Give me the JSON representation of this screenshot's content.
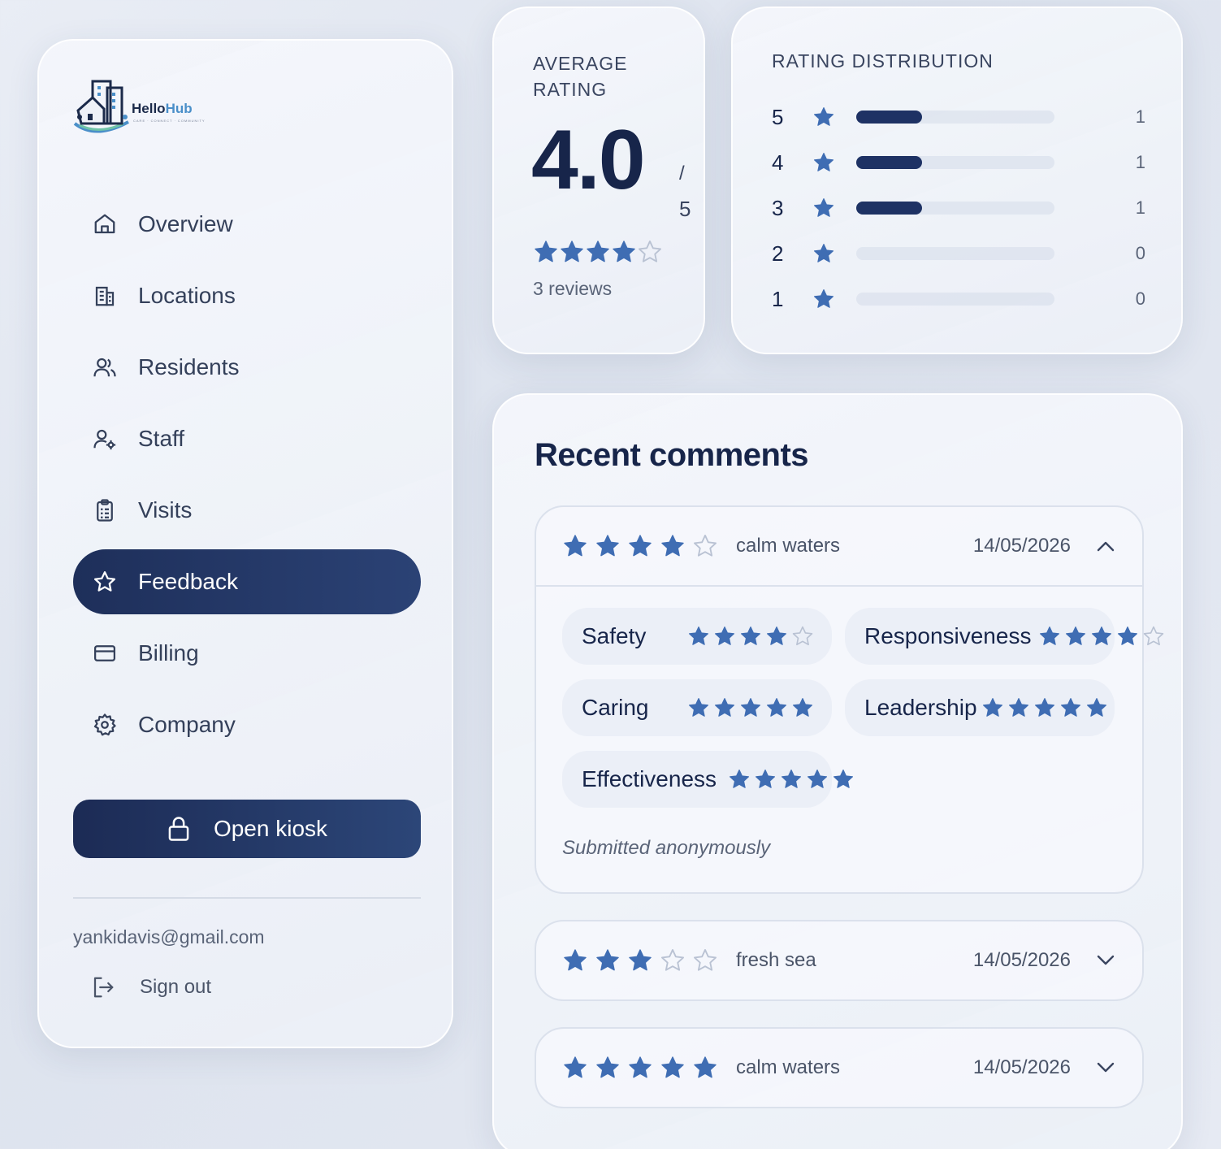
{
  "brand": {
    "name_a": "Hello",
    "name_b": "Hub",
    "tagline": "CARE · CONNECT · COMMUNITY"
  },
  "sidebar": {
    "items": [
      {
        "label": "Overview",
        "icon": "home-icon",
        "active": false
      },
      {
        "label": "Locations",
        "icon": "building-icon",
        "active": false
      },
      {
        "label": "Residents",
        "icon": "users-icon",
        "active": false
      },
      {
        "label": "Staff",
        "icon": "user-gear-icon",
        "active": false
      },
      {
        "label": "Visits",
        "icon": "clipboard-icon",
        "active": false
      },
      {
        "label": "Feedback",
        "icon": "star-icon",
        "active": true
      },
      {
        "label": "Billing",
        "icon": "card-icon",
        "active": false
      },
      {
        "label": "Company",
        "icon": "gear-icon",
        "active": false
      }
    ],
    "kiosk_label": "Open kiosk",
    "email": "yankidavis@gmail.com",
    "signout_label": "Sign out"
  },
  "average": {
    "label": "AVERAGE RATING",
    "value": "4.0",
    "slash": "/",
    "max": "5",
    "stars": 4,
    "reviews": "3 reviews"
  },
  "distribution": {
    "label": "RATING DISTRIBUTION",
    "rows": [
      {
        "stars": "5",
        "count": "1",
        "fraction": 0.33
      },
      {
        "stars": "4",
        "count": "1",
        "fraction": 0.33
      },
      {
        "stars": "3",
        "count": "1",
        "fraction": 0.33
      },
      {
        "stars": "2",
        "count": "0",
        "fraction": 0
      },
      {
        "stars": "1",
        "count": "0",
        "fraction": 0
      }
    ]
  },
  "comments": {
    "title": "Recent comments",
    "items": [
      {
        "rating": 4,
        "name": "calm waters",
        "date": "14/05/2026",
        "expanded": true,
        "criteria": [
          {
            "label": "Safety",
            "rating": 4
          },
          {
            "label": "Responsiveness",
            "rating": 4
          },
          {
            "label": "Caring",
            "rating": 5
          },
          {
            "label": "Leadership",
            "rating": 5
          },
          {
            "label": "Effectiveness",
            "rating": 5
          }
        ],
        "note": "Submitted anonymously"
      },
      {
        "rating": 3,
        "name": "fresh sea",
        "date": "14/05/2026",
        "expanded": false
      },
      {
        "rating": 5,
        "name": "calm waters",
        "date": "14/05/2026",
        "expanded": false
      }
    ]
  },
  "colors": {
    "accent": "#1e3264",
    "star": "#3f6db3",
    "star_empty": "#b9c2d3"
  }
}
